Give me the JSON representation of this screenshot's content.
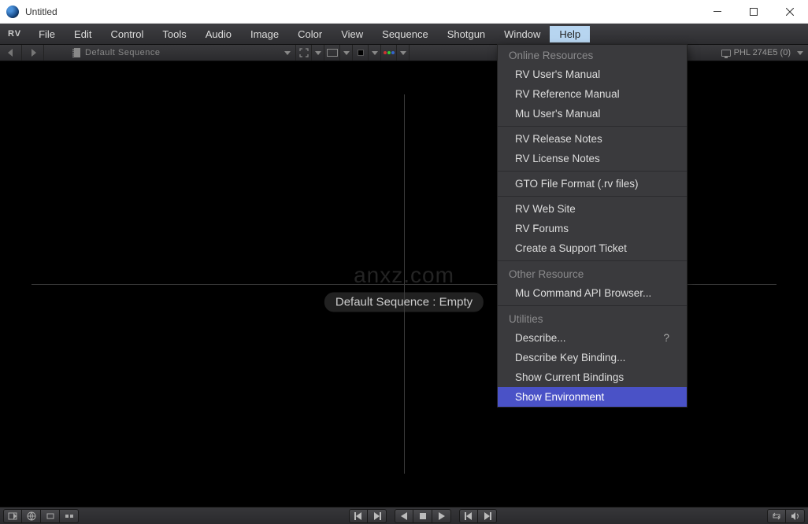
{
  "window": {
    "title": "Untitled"
  },
  "menubar": {
    "logo": "RV",
    "items": [
      "File",
      "Edit",
      "Control",
      "Tools",
      "Audio",
      "Image",
      "Color",
      "View",
      "Sequence",
      "Shotgun",
      "Window",
      "Help"
    ],
    "active_index": 11
  },
  "toolbar": {
    "sequence_label": "Default Sequence",
    "monitor_label": "PHL 274E5 (0)"
  },
  "viewport": {
    "center_label": "Default Sequence : Empty",
    "watermark": "anxz.com"
  },
  "helpmenu": {
    "sections": [
      {
        "header": "Online Resources",
        "items": [
          {
            "label": "RV User's Manual"
          },
          {
            "label": "RV Reference Manual"
          },
          {
            "label": "Mu User's Manual"
          }
        ]
      },
      {
        "header": null,
        "items": [
          {
            "label": "RV Release Notes"
          },
          {
            "label": "RV License Notes"
          }
        ]
      },
      {
        "header": null,
        "items": [
          {
            "label": "GTO File Format (.rv files)"
          }
        ]
      },
      {
        "header": null,
        "items": [
          {
            "label": "RV Web Site"
          },
          {
            "label": "RV Forums"
          },
          {
            "label": "Create a Support Ticket"
          }
        ]
      },
      {
        "header": "Other Resource",
        "items": [
          {
            "label": "Mu Command API Browser..."
          }
        ]
      },
      {
        "header": "Utilities",
        "items": [
          {
            "label": "Describe...",
            "shortcut": "?"
          },
          {
            "label": "Describe Key Binding..."
          },
          {
            "label": "Show Current Bindings"
          },
          {
            "label": "Show Environment",
            "highlight": true
          }
        ]
      }
    ]
  }
}
